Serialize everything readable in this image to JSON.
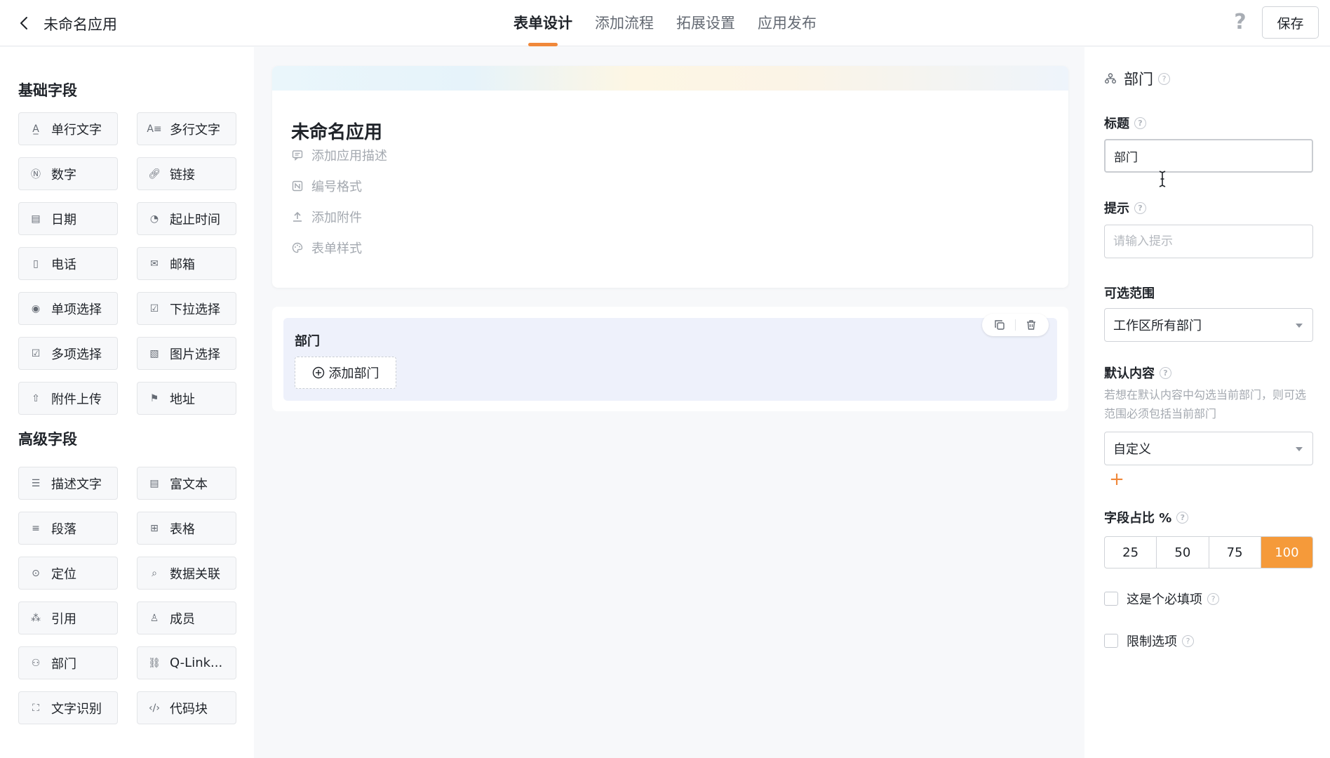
{
  "header": {
    "app_title": "未命名应用",
    "tabs": [
      {
        "label": "表单设计",
        "active": true
      },
      {
        "label": "添加流程",
        "active": false
      },
      {
        "label": "拓展设置",
        "active": false
      },
      {
        "label": "应用发布",
        "active": false
      }
    ],
    "help_label": "?",
    "save_label": "保存"
  },
  "left": {
    "basic_title": "基础字段",
    "basic_fields": [
      {
        "label": "单行文字",
        "icon": "text-line-icon"
      },
      {
        "label": "多行文字",
        "icon": "text-multiline-icon"
      },
      {
        "label": "数字",
        "icon": "number-icon"
      },
      {
        "label": "链接",
        "icon": "link-icon"
      },
      {
        "label": "日期",
        "icon": "calendar-icon"
      },
      {
        "label": "起止时间",
        "icon": "time-range-icon"
      },
      {
        "label": "电话",
        "icon": "phone-icon"
      },
      {
        "label": "邮箱",
        "icon": "mail-icon"
      },
      {
        "label": "单项选择",
        "icon": "radio-icon"
      },
      {
        "label": "下拉选择",
        "icon": "dropdown-icon"
      },
      {
        "label": "多项选择",
        "icon": "checkbox-icon"
      },
      {
        "label": "图片选择",
        "icon": "image-icon"
      },
      {
        "label": "附件上传",
        "icon": "upload-icon"
      },
      {
        "label": "地址",
        "icon": "address-icon"
      }
    ],
    "advanced_title": "高级字段",
    "advanced_fields": [
      {
        "label": "描述文字",
        "icon": "description-icon"
      },
      {
        "label": "富文本",
        "icon": "rich-text-icon"
      },
      {
        "label": "段落",
        "icon": "paragraph-icon"
      },
      {
        "label": "表格",
        "icon": "table-icon"
      },
      {
        "label": "定位",
        "icon": "location-icon"
      },
      {
        "label": "数据关联",
        "icon": "data-link-icon"
      },
      {
        "label": "引用",
        "icon": "reference-icon"
      },
      {
        "label": "成员",
        "icon": "member-icon"
      },
      {
        "label": "部门",
        "icon": "department-icon"
      },
      {
        "label": "Q-Link...",
        "icon": "qlink-icon"
      },
      {
        "label": "文字识别",
        "icon": "ocr-icon"
      },
      {
        "label": "代码块",
        "icon": "code-icon"
      }
    ]
  },
  "canvas": {
    "form_title": "未命名应用",
    "meta": [
      {
        "label": "添加应用描述",
        "icon": "comment-icon"
      },
      {
        "label": "编号格式",
        "icon": "number-format-icon"
      },
      {
        "label": "添加附件",
        "icon": "upload-icon"
      },
      {
        "label": "表单样式",
        "icon": "palette-icon"
      }
    ],
    "field": {
      "label": "部门",
      "add_button": "添加部门"
    }
  },
  "right": {
    "header_title": "部门",
    "title_label": "标题",
    "title_value": "部门",
    "hint_label": "提示",
    "hint_placeholder": "请输入提示",
    "range_label": "可选范围",
    "range_value": "工作区所有部门",
    "default_label": "默认内容",
    "default_hint": "若想在默认内容中勾选当前部门，则可选范围必须包括当前部门",
    "default_value": "自定义",
    "add_symbol": "+",
    "width_label": "字段占比 %",
    "width_options": [
      "25",
      "50",
      "75",
      "100"
    ],
    "width_selected": "100",
    "required_label": "这是个必填项",
    "limit_label": "限制选项",
    "accent_color": "#f59a3a"
  }
}
